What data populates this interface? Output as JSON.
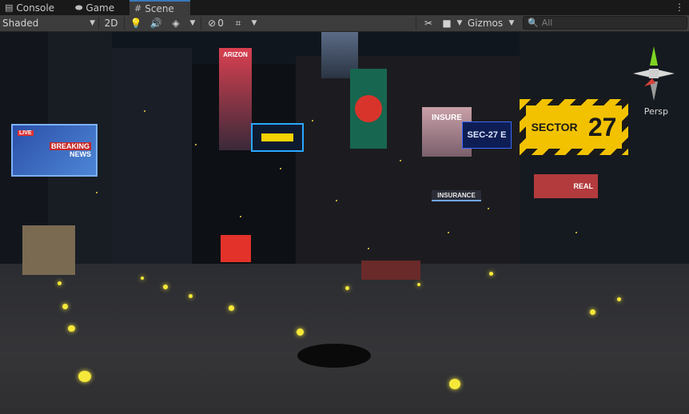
{
  "tabs": [
    {
      "label": "Console",
      "icon": "console-icon",
      "active": false
    },
    {
      "label": "Game",
      "icon": "game-controller-icon",
      "active": false
    },
    {
      "label": "Scene",
      "icon": "scene-grid-icon",
      "active": true
    }
  ],
  "toolbar": {
    "shading_mode": "Shaded",
    "mode_2d": "2D",
    "hidden_count": "0",
    "gizmos_label": "Gizmos",
    "search_placeholder": "All"
  },
  "viewport": {
    "projection_label": "Persp",
    "signs": {
      "breaking_title": "BREAKING",
      "breaking_sub": "NEWS",
      "breaking_live": "LIVE",
      "sector_word": "SECTOR",
      "sector_number": "27",
      "sec27": "SEC-27 E",
      "insure": "INSURE",
      "insurance": "INSURANCE",
      "real": "REAL",
      "arizon": "ARIZON"
    }
  },
  "colors": {
    "accent": "#3a79bb",
    "sector_yellow": "#f2c200",
    "particle_yellow": "#f6e83a",
    "gizmo_green": "#7ed321",
    "gizmo_red": "#d6413a"
  }
}
